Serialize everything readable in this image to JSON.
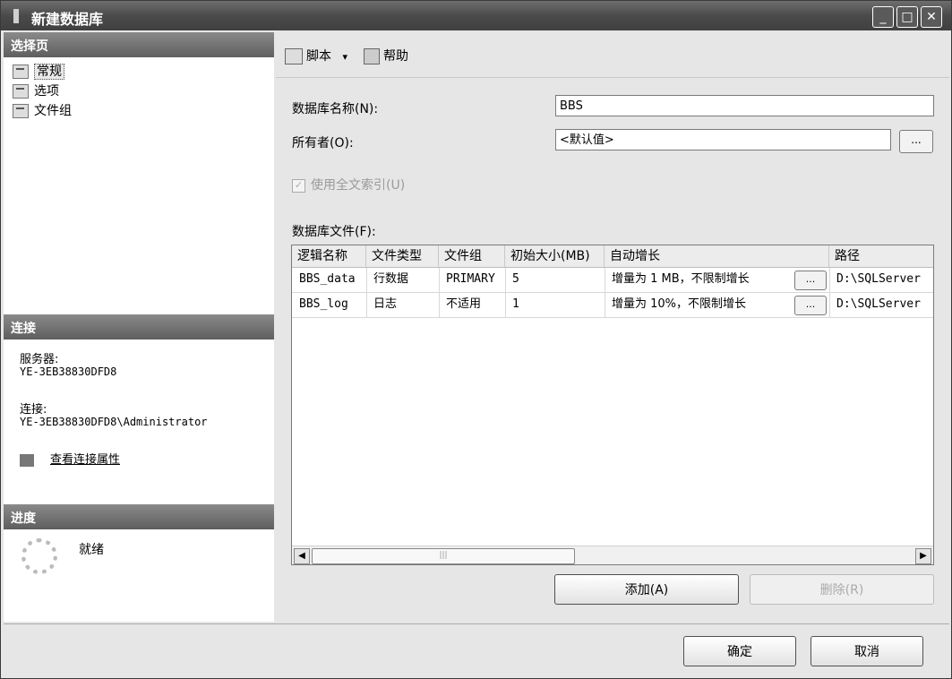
{
  "window": {
    "title": "新建数据库"
  },
  "left": {
    "select_page_header": "选择页",
    "pages": [
      {
        "label": "常规"
      },
      {
        "label": "选项"
      },
      {
        "label": "文件组"
      }
    ],
    "connection_header": "连接",
    "server_label": "服务器:",
    "server_value": "YE-3EB38830DFD8",
    "connection_label": "连接:",
    "connection_value": "YE-3EB38830DFD8\\Administrator",
    "view_props_link": "查看连接属性",
    "progress_header": "进度",
    "progress_status": "就绪"
  },
  "toolbar": {
    "script_label": "脚本",
    "dropdown_arrow": "▾",
    "help_label": "帮助"
  },
  "form": {
    "db_name_label": "数据库名称(N):",
    "db_name_value": "BBS",
    "owner_label": "所有者(O):",
    "owner_value": "<默认值>",
    "ellipsis": "...",
    "fulltext_label": "使用全文索引(U)",
    "db_files_label": "数据库文件(F):"
  },
  "grid": {
    "headers": [
      "逻辑名称",
      "文件类型",
      "文件组",
      "初始大小(MB)",
      "自动增长",
      "路径"
    ],
    "rows": [
      {
        "name": "BBS_data",
        "type": "行数据",
        "group": "PRIMARY",
        "size": "5",
        "growth": "增量为 1 MB，不限制增长",
        "path": "D:\\SQLServer"
      },
      {
        "name": "BBS_log",
        "type": "日志",
        "group": "不适用",
        "size": "1",
        "growth": "增量为 10%，不限制增长",
        "path": "D:\\SQLServer"
      }
    ],
    "scroll_left": "◀",
    "scroll_right": "▶",
    "scroll_grip": "|||"
  },
  "buttons": {
    "add": "添加(A)",
    "remove": "删除(R)",
    "ok": "确定",
    "cancel": "取消"
  },
  "title_buttons": {
    "minimize": "_",
    "maximize": "□",
    "close": "✕"
  }
}
